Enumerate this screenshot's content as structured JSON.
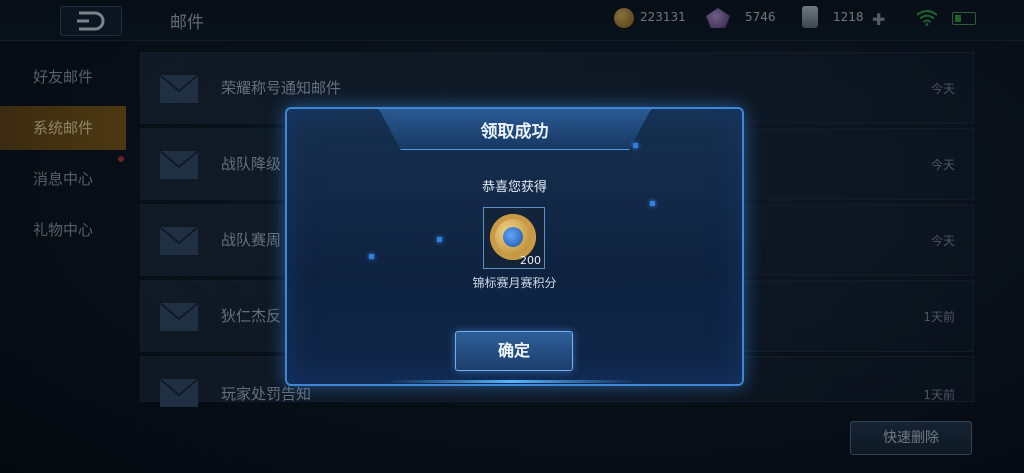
{
  "header": {
    "title": "邮件",
    "gold": "223131",
    "gems": "5746",
    "cards": "1218"
  },
  "sidebar": {
    "items": [
      {
        "label": "好友邮件"
      },
      {
        "label": "系统邮件"
      },
      {
        "label": "消息中心"
      },
      {
        "label": "礼物中心"
      }
    ]
  },
  "mails": [
    {
      "subject": "荣耀称号通知邮件",
      "time": "今天"
    },
    {
      "subject": "战队降级",
      "time": "今天"
    },
    {
      "subject": "战队赛周",
      "time": "今天"
    },
    {
      "subject": "狄仁杰反",
      "time": "1天前"
    },
    {
      "subject": "玩家处罚告知",
      "time": "1天前"
    }
  ],
  "footer": {
    "delete_label": "快速删除"
  },
  "modal": {
    "title": "领取成功",
    "subtitle": "恭喜您获得",
    "reward_qty": "200",
    "reward_name": "锦标赛月赛积分",
    "confirm_label": "确定"
  },
  "colors": {
    "accent": "#3f86d6",
    "active_tab": "#8a6217"
  },
  "icons": [
    "back-icon",
    "gold-coin-icon",
    "gem-icon",
    "card-icon",
    "plus-icon",
    "wifi-icon",
    "battery-icon",
    "envelope-icon",
    "medal-icon"
  ]
}
